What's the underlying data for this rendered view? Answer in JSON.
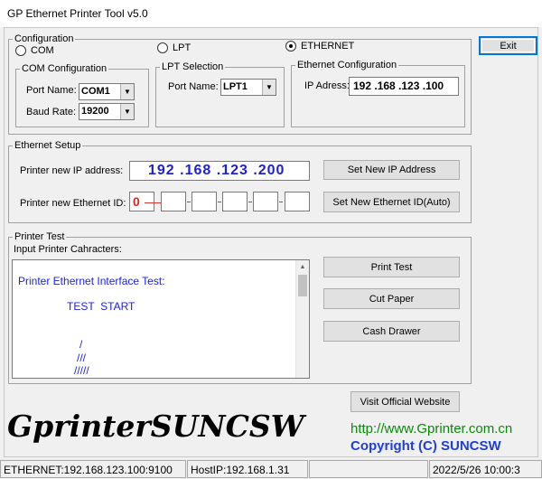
{
  "window": {
    "title": "GP Ethernet Printer Tool v5.0"
  },
  "exit_label": "Exit",
  "configuration": {
    "legend": "Configuration",
    "radios": [
      {
        "label": "COM",
        "checked": false
      },
      {
        "label": "LPT",
        "checked": false
      },
      {
        "label": "ETHERNET",
        "checked": true
      }
    ],
    "com": {
      "legend": "COM Configuration",
      "port_label": "Port Name:",
      "port_value": "COM1",
      "baud_label": "Baud Rate:",
      "baud_value": "19200"
    },
    "lpt": {
      "legend": "LPT Selection",
      "port_label": "Port Name:",
      "port_value": "LPT1"
    },
    "ethernet": {
      "legend": "Ethernet Configuration",
      "ip_label": "IP Adress:",
      "ip_value": "192 .168 .123 .100"
    }
  },
  "ethernet_setup": {
    "legend": "Ethernet Setup",
    "new_ip_label": "Printer new IP address:",
    "new_ip_value": "192 .168 .123 .200",
    "set_ip_button": "Set New IP Address",
    "new_id_label": "Printer new Ethernet ID:",
    "id_first": "0",
    "set_id_button": "Set New Ethernet ID(Auto)"
  },
  "printer_test": {
    "legend": "Printer Test",
    "input_label": "Input Printer Cahracters:",
    "text_lines": [
      "Printer Ethernet Interface Test:",
      "TEST  START",
      "/",
      "///",
      "/////"
    ],
    "buttons": {
      "print_test": "Print Test",
      "cut_paper": "Cut Paper",
      "cash_drawer": "Cash Drawer"
    }
  },
  "visit_button": "Visit Official Website",
  "logo": "GprinterSUNCSW",
  "url": "http://www.Gprinter.com.cn",
  "copyright": "Copyright (C) SUNCSW",
  "status": {
    "ethernet": "ETHERNET:192.168.123.100:9100",
    "host": "HostIP:192.168.1.31",
    "blank": "",
    "datetime": "2022/5/26 10:00:3"
  },
  "colors": {
    "blue": "#1f1fd6",
    "green": "#0a8a0a",
    "red": "#dd2222",
    "accent": "#0078d7"
  },
  "icons": {
    "dropdown": "chevron-down-icon",
    "scroll_up": "scroll-up-icon",
    "scroll_down": "scroll-down-icon"
  }
}
